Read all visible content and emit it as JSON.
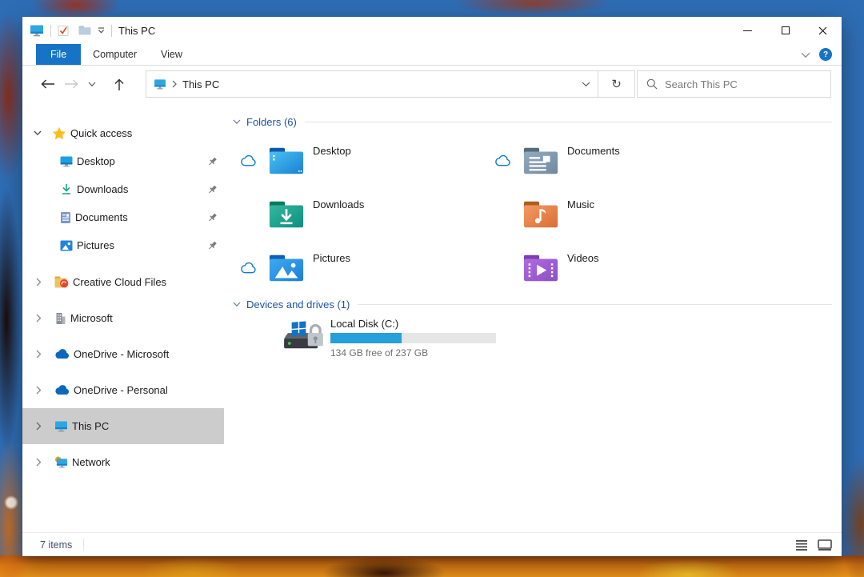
{
  "colors": {
    "accent": "#1673c6",
    "selection_gray": "#cccccc",
    "drive_bar_fill": "#26a0da",
    "group_header_blue": "#1d54a0"
  },
  "titlebar": {
    "title": "This PC",
    "icons": [
      "this-pc-app-icon",
      "properties-check-icon",
      "new-folder-icon",
      "qat-dropdown-icon"
    ]
  },
  "ribbon": {
    "tabs": [
      {
        "label": "File",
        "active": true
      },
      {
        "label": "Computer",
        "active": false
      },
      {
        "label": "View",
        "active": false
      }
    ],
    "help_label": "?"
  },
  "nav": {
    "address": {
      "location": "This PC"
    },
    "search": {
      "placeholder": "Search This PC"
    },
    "refresh_glyph": "↻"
  },
  "sidebar": {
    "items": [
      {
        "label": "Quick access",
        "icon": "star",
        "expanded": true
      },
      {
        "label": "Desktop",
        "icon": "desktop",
        "pinned": true
      },
      {
        "label": "Downloads",
        "icon": "downloads-arrow",
        "pinned": true
      },
      {
        "label": "Documents",
        "icon": "document",
        "pinned": true
      },
      {
        "label": "Pictures",
        "icon": "picture",
        "pinned": true
      },
      {
        "label": "Creative Cloud Files",
        "icon": "creative-cloud-folder"
      },
      {
        "label": "Microsoft",
        "icon": "building"
      },
      {
        "label": "OneDrive - Microsoft",
        "icon": "onedrive-cloud"
      },
      {
        "label": "OneDrive - Personal",
        "icon": "onedrive-cloud"
      },
      {
        "label": "This PC",
        "icon": "monitor",
        "selected": true
      },
      {
        "label": "Network",
        "icon": "network-monitor"
      }
    ]
  },
  "main": {
    "folders_section": {
      "title": "Folders (6)",
      "tiles": [
        {
          "label": "Desktop",
          "cloud": true
        },
        {
          "label": "Documents",
          "cloud": true
        },
        {
          "label": "Downloads",
          "cloud": false
        },
        {
          "label": "Music",
          "cloud": false
        },
        {
          "label": "Pictures",
          "cloud": true
        },
        {
          "label": "Videos",
          "cloud": false
        }
      ]
    },
    "devices_section": {
      "title": "Devices and drives (1)",
      "drives": [
        {
          "name": "Local Disk (C:)",
          "free_text": "134 GB free of 237 GB",
          "used_percent": 43
        }
      ]
    }
  },
  "statusbar": {
    "items_count": "7 items"
  }
}
